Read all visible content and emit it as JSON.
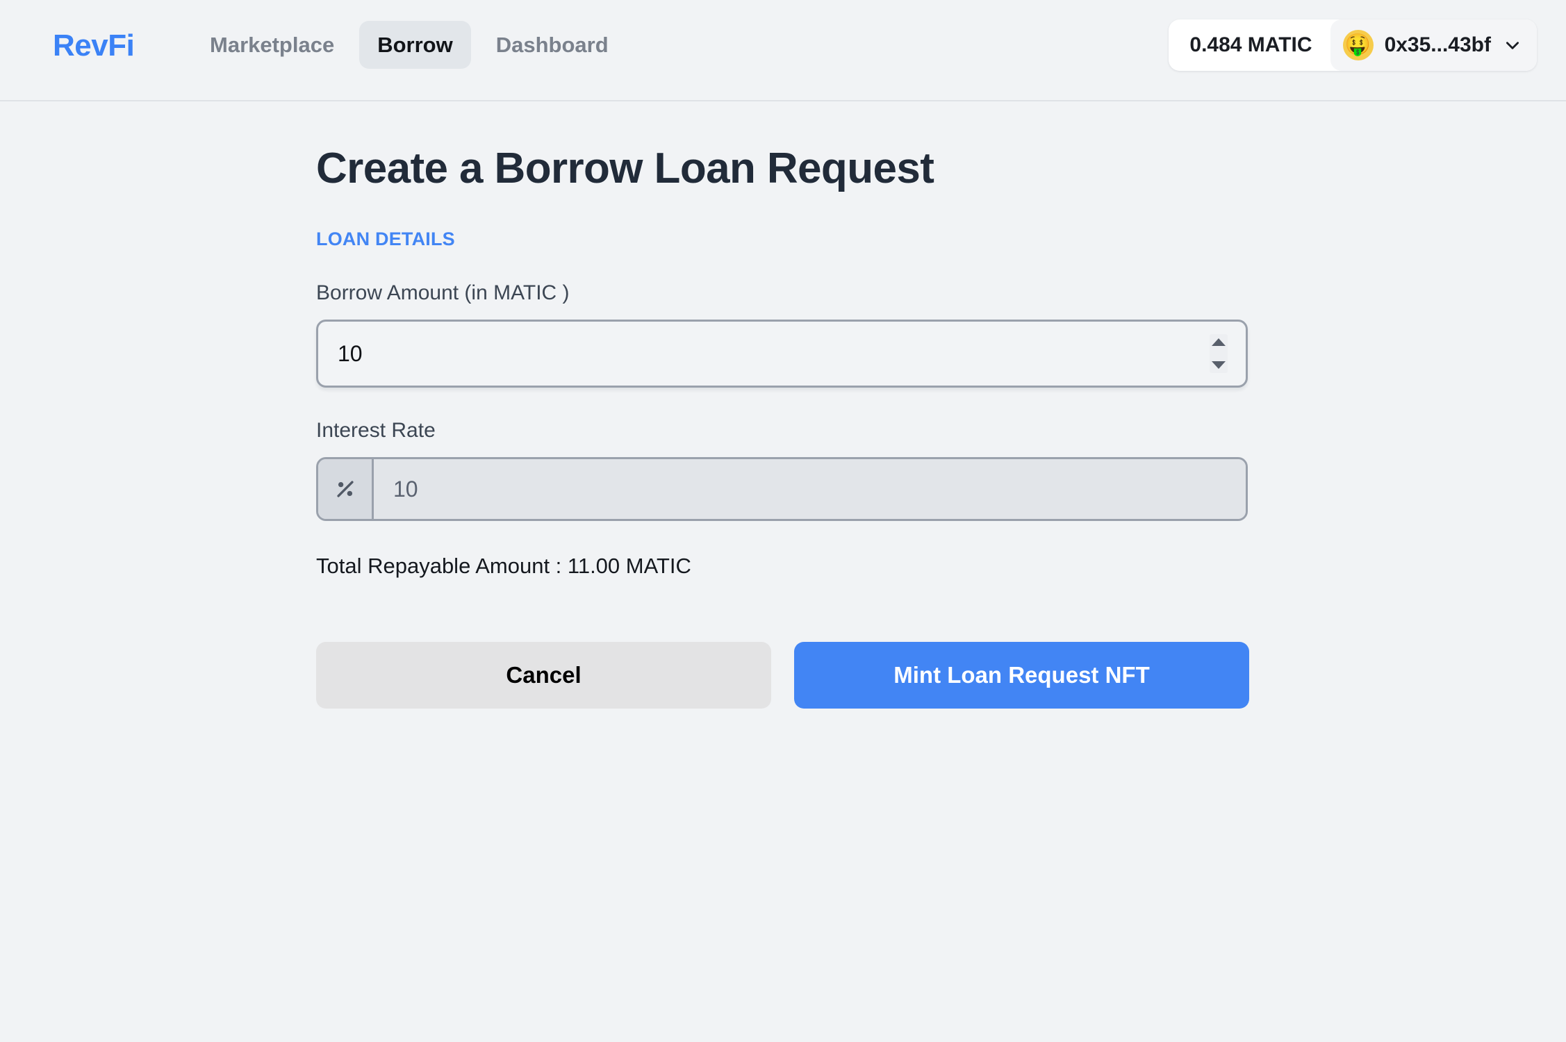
{
  "header": {
    "brand": "RevFi",
    "nav": [
      {
        "label": "Marketplace",
        "active": false
      },
      {
        "label": "Borrow",
        "active": true
      },
      {
        "label": "Dashboard",
        "active": false
      }
    ],
    "wallet": {
      "balance": "0.484 MATIC",
      "address": "0x35...43bf",
      "avatar_emoji": "🤑",
      "avatar_icon": "money-mouth-face-emoji",
      "chevron_icon": "chevron-down-icon"
    }
  },
  "main": {
    "title": "Create a Borrow Loan Request",
    "section_label": "LOAN DETAILS",
    "fields": {
      "borrow_amount": {
        "label": "Borrow Amount (in MATIC )",
        "value": "10",
        "placeholder": "10",
        "spinner_up_icon": "spinner-up-arrow-icon",
        "spinner_down_icon": "spinner-down-arrow-icon"
      },
      "interest_rate": {
        "label": "Interest Rate",
        "value": "10",
        "placeholder": "10",
        "addon_icon": "percent-icon",
        "disabled": true
      }
    },
    "total_repayable": "Total Repayable Amount : 11.00 MATIC",
    "actions": {
      "cancel_label": "Cancel",
      "submit_label": "Mint Loan Request NFT"
    }
  },
  "colors": {
    "accent_blue": "#4285F4",
    "brand_blue": "#3B82F6",
    "page_background": "#F1F3F5",
    "active_tab_background": "#E2E6EA",
    "cancel_background": "#E3E3E4",
    "muted_text": "#7A818C",
    "title_text": "#212B39"
  }
}
